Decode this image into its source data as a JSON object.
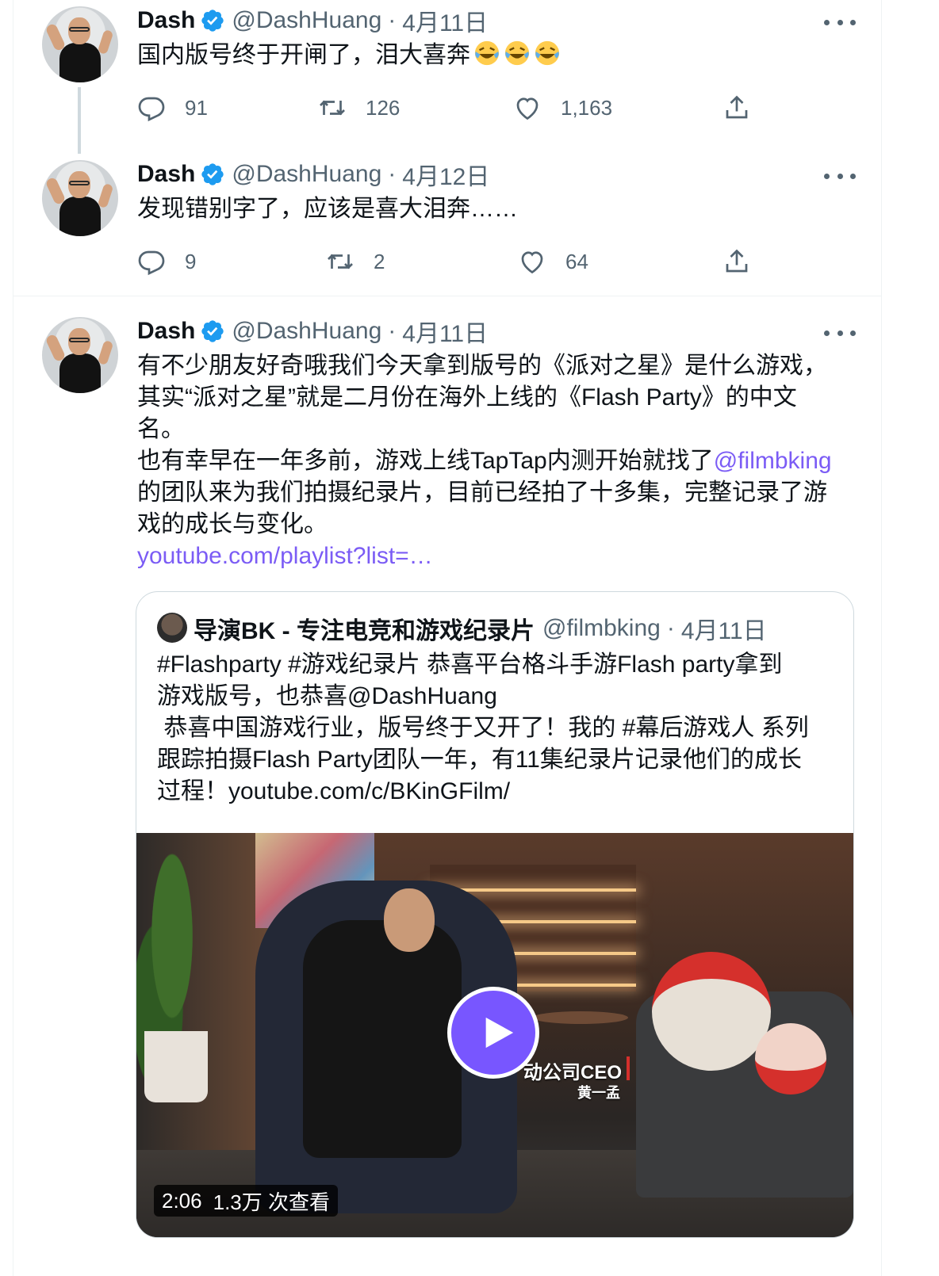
{
  "colors": {
    "link": "#7b5cf5",
    "verified": "#1d9bf0",
    "muted": "#536471",
    "play_button": "#7856ff"
  },
  "tweets": [
    {
      "name": "Dash",
      "handle": "@DashHuang",
      "separator": "·",
      "date": "4月11日",
      "text": "国内版号终于开闸了，泪大喜奔",
      "emoji": [
        "rolling-on-floor-laughing",
        "rolling-on-floor-laughing",
        "rolling-on-floor-laughing"
      ],
      "replies": "91",
      "retweets": "126",
      "likes": "1,163"
    },
    {
      "name": "Dash",
      "handle": "@DashHuang",
      "separator": "·",
      "date": "4月12日",
      "text": "发现错别字了，应该是喜大泪奔……",
      "replies": "9",
      "retweets": "2",
      "likes": "64"
    },
    {
      "name": "Dash",
      "handle": "@DashHuang",
      "separator": "·",
      "date": "4月11日",
      "lines": [
        "有不少朋友好奇哦我们今天拿到版号的《派对之星》是什么游戏，",
        "其实“派对之星”就是二月份在海外上线的《Flash Party》的中文",
        "名。",
        "也有幸早在一年多前，游戏上线TapTap内测开始就找了",
        "的团队来为我们拍摄纪录片，目前已经拍了十多集，完整记录了游",
        "戏的成长与变化。"
      ],
      "mention": "@filmbking",
      "link": "youtube.com/playlist?list=…"
    }
  ],
  "quote": {
    "name": "导演BK - 专注电竞和游戏纪录片",
    "handle": "@filmbking",
    "separator": "·",
    "date": "4月11日",
    "lines": [
      "#Flashparty #游戏纪录片 恭喜平台格斗手游Flash party拿到",
      "游戏版号，也恭喜@DashHuang",
      " 恭喜中国游戏行业，版号终于又开了！我的 #幕后游戏人 系列",
      "跟踪拍摄Flash Party团队一年，有11集纪录片记录他们的成长",
      "过程！youtube.com/c/BKinGFilm/"
    ],
    "video": {
      "duration": "2:06",
      "views": "1.3万 次查看",
      "caption": "动公司CEO",
      "caption_sub": "黄一孟"
    }
  }
}
